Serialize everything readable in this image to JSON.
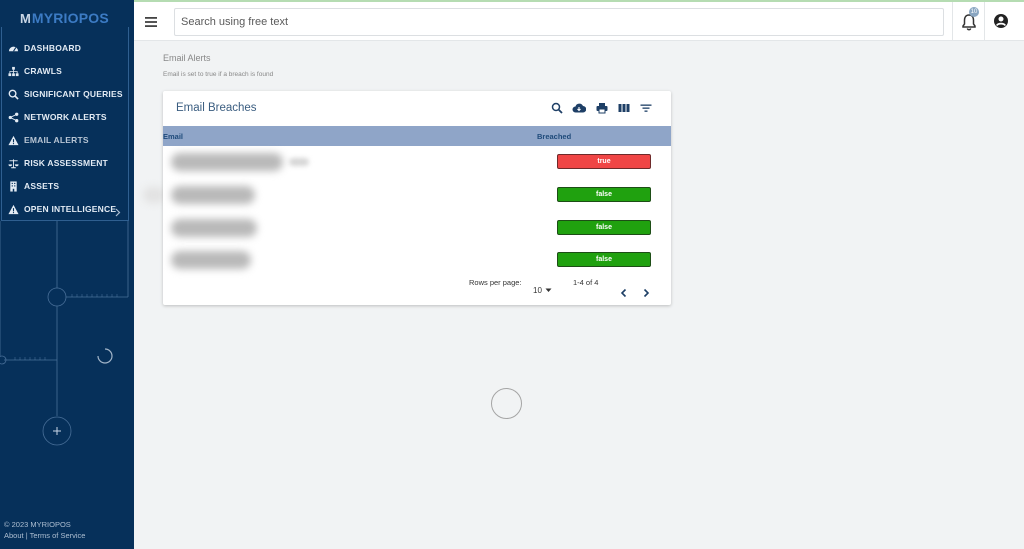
{
  "brand": {
    "logo_text": "MYRIOPOS",
    "logo_mark": "M"
  },
  "search": {
    "placeholder": "Search using free text"
  },
  "notifications": {
    "count": "10"
  },
  "sidebar": {
    "items": [
      {
        "label": "DASHBOARD",
        "icon": "dashboard-icon"
      },
      {
        "label": "CRAWLS",
        "icon": "sitemap-icon"
      },
      {
        "label": "SIGNIFICANT QUERIES",
        "icon": "search-icon"
      },
      {
        "label": "NETWORK ALERTS",
        "icon": "share-icon"
      },
      {
        "label": "EMAIL ALERTS",
        "icon": "warning-icon",
        "active": true
      },
      {
        "label": "RISK ASSESSMENT",
        "icon": "balance-scale-icon"
      },
      {
        "label": "ASSETS",
        "icon": "building-icon"
      },
      {
        "label": "OPEN INTELLIGENCE",
        "icon": "warning-icon",
        "has_submenu": true
      }
    ],
    "footer": {
      "copyright": "© 2023 MYRIOPOS",
      "about": "About",
      "separator": "|",
      "terms": "Terms of Service"
    }
  },
  "page": {
    "title": "Email Alerts",
    "subtitle": "Email is set to true if a breach is found"
  },
  "card": {
    "title": "Email Breaches",
    "toolbar": [
      "search-icon",
      "cloud-download-icon",
      "print-icon",
      "view-column-icon",
      "filter-icon"
    ],
    "columns": {
      "email": "Email",
      "breached": "Breached"
    },
    "rows": [
      {
        "email": "",
        "breached": "true"
      },
      {
        "email": "",
        "breached": "false"
      },
      {
        "email": "",
        "breached": "false"
      },
      {
        "email": "",
        "breached": "false"
      }
    ],
    "pagination": {
      "rows_per_page_label": "Rows per page:",
      "rows_per_page": "10",
      "range": "1-4 of 4"
    }
  },
  "colors": {
    "sidebar": "#06305a",
    "header_row": "#8fa5c8",
    "true": "#f04545",
    "false": "#20a10f"
  }
}
